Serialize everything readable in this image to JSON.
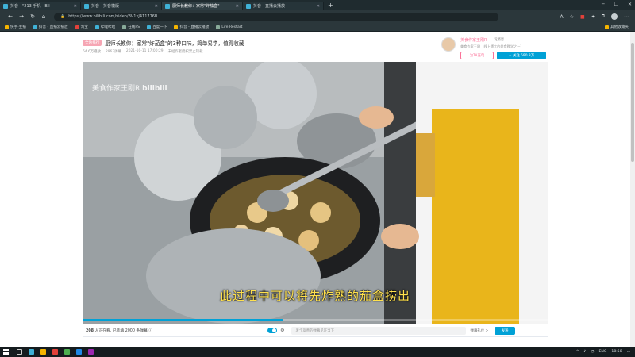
{
  "browser": {
    "tabs": [
      {
        "label": "抖音 - \"213 手机 - Bil"
      },
      {
        "label": "抖音 - 抖音模版"
      },
      {
        "label": "厨师长教你：家常\"炸茄盒\""
      },
      {
        "label": "抖音 - 直播云播放"
      }
    ],
    "address": "https://www.bilibili.com/video/BV1xJ411776B",
    "bookmarks": [
      {
        "label": "快手·主播"
      },
      {
        "label": "抖音 - 直播云播放"
      },
      {
        "label": "淘宝"
      },
      {
        "label": "哔哩哔哩"
      },
      {
        "label": "在线PS"
      },
      {
        "label": "百度一下"
      },
      {
        "label": "抖音 - 直播云播放"
      },
      {
        "label": "Life Restart"
      }
    ],
    "bookmarks_other": "其他收藏夹"
  },
  "video": {
    "badge": "全站排行",
    "title": "厨师长教你：家常\"炸茄盒\"的3种口味，简单易学，值得收藏",
    "views": "64.6万播放",
    "danmaku_total": "2963弹幕",
    "date": "2021-10-11 17:00:29",
    "notice": "未经作者授权禁止转载",
    "watermark": "美食作家王刚R",
    "watermark_logo": "bilibili",
    "subtitle": "此过程中可以将先炸熟的茄盒捞出",
    "progress": 0.43
  },
  "uploader": {
    "name": "美食作家王刚R",
    "msg": "发消息",
    "desc": "美食作家王刚（线上博大的美食教学之一）",
    "charge_label": "为TA充电",
    "follow_label": "+ 关注 590.3万"
  },
  "danmaku_bar": {
    "count": "208",
    "count_text": " 人正在看, 已装填 2000 条弹幕",
    "input_placeholder": "发个友善的弹幕见证当下",
    "etiquette": "弹幕礼仪 >",
    "send_label": "发送"
  },
  "taskbar": {
    "lang": "ENG",
    "time": "18:58"
  },
  "colors": {
    "bili_blue": "#00a1d6",
    "bili_pink": "#fb7299",
    "subtitle_yellow": "#ffe14d"
  }
}
